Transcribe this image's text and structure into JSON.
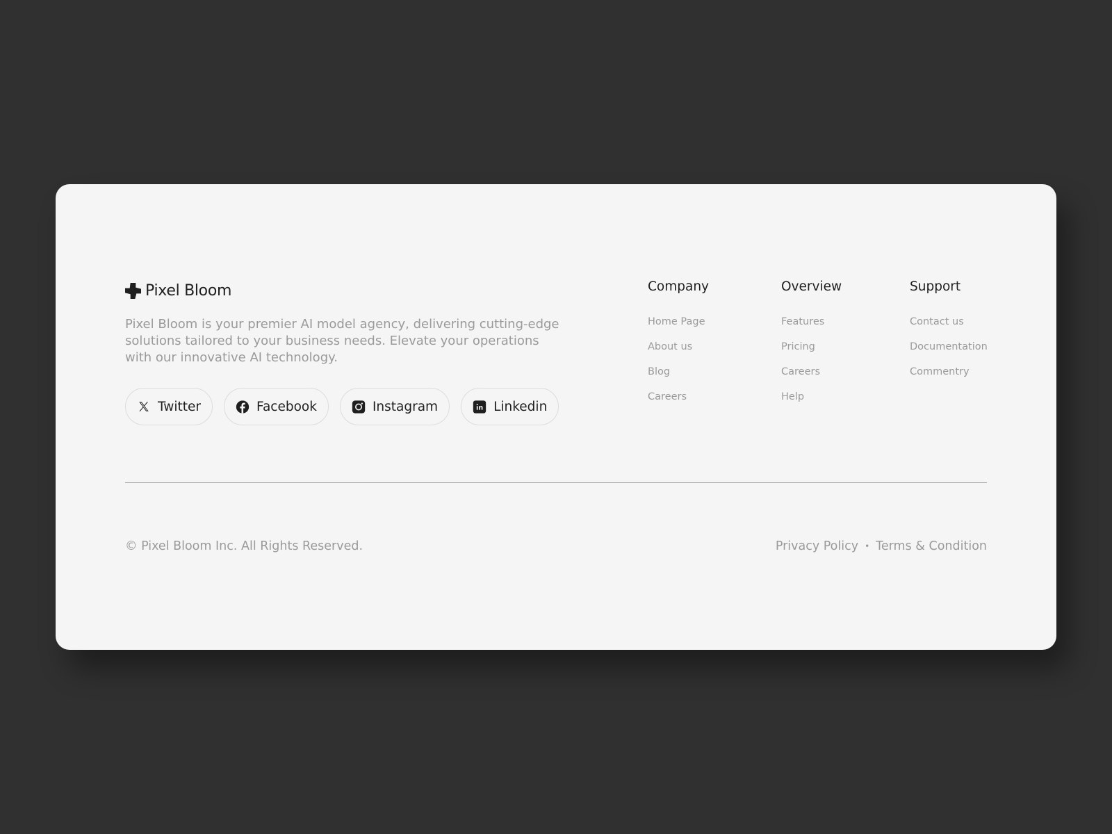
{
  "brand": {
    "name": "Pixel Bloom",
    "tagline": "Pixel Bloom is your premier AI model agency, delivering cutting-edge solutions tailored to your business needs. Elevate your operations with our innovative AI technology."
  },
  "socials": [
    {
      "label": "Twitter",
      "icon": "x-twitter-icon"
    },
    {
      "label": "Facebook",
      "icon": "facebook-icon"
    },
    {
      "label": "Instagram",
      "icon": "instagram-icon"
    },
    {
      "label": "Linkedin",
      "icon": "linkedin-icon"
    }
  ],
  "columns": [
    {
      "title": "Company",
      "links": [
        "Home Page",
        "About us",
        "Blog",
        "Careers"
      ]
    },
    {
      "title": "Overview",
      "links": [
        "Features",
        "Pricing",
        "Careers",
        "Help"
      ]
    },
    {
      "title": "Support",
      "links": [
        "Contact us",
        "Documentation",
        "Commentry"
      ]
    }
  ],
  "footer": {
    "copyright": "© Pixel Bloom Inc. All Rights Reserved.",
    "privacy": "Privacy Policy",
    "separator": "•",
    "terms": "Terms & Condition"
  },
  "colors": {
    "background": "#303030",
    "card": "#f5f5f5",
    "text_dark": "#1f1f1f",
    "text_muted": "#9a9a9a"
  }
}
